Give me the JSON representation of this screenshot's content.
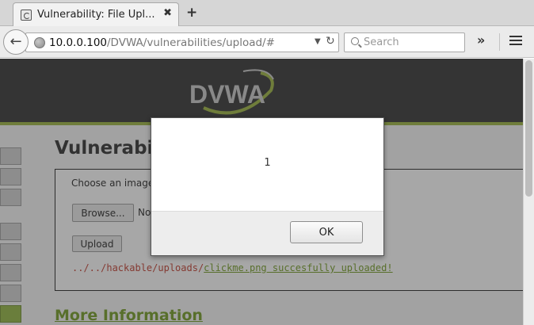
{
  "browser": {
    "tab_title": "Vulnerability: File Upl...",
    "tab_close": "✖",
    "new_tab": "+",
    "url_host": "10.0.0.100",
    "url_path": "/DVWA/vulnerabilities/upload/#",
    "search_placeholder": "Search",
    "overflow": "»"
  },
  "page": {
    "logo_text": "DVWA",
    "title": "Vulnerabili",
    "choose_label": "Choose an image",
    "browse_label": "Browse...",
    "nofile_text": "No",
    "upload_label": "Upload",
    "result_prefix": "../../hackable/uploads/",
    "result_link": "clickme.png succesfully uploaded!",
    "more_info": "More Information"
  },
  "dialog": {
    "message": "1",
    "ok_label": "OK"
  },
  "colors": {
    "accent_green": "#9ab23b",
    "header_dark": "#2f2f2f",
    "error_red": "#c0392b"
  }
}
